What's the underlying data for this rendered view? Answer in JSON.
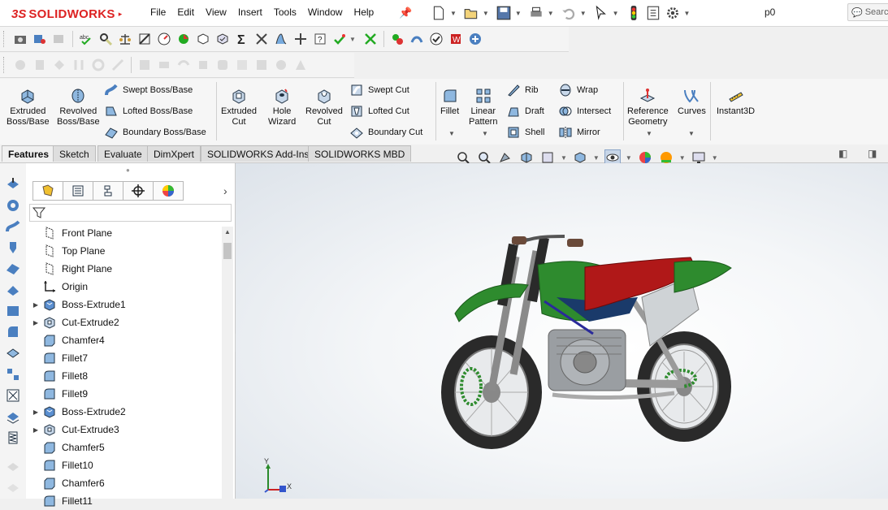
{
  "app": {
    "logo_text": "SOLIDWORKS",
    "document_name": "p0",
    "search_placeholder": "Search"
  },
  "menu": [
    "File",
    "Edit",
    "View",
    "Insert",
    "Tools",
    "Window",
    "Help"
  ],
  "command_manager": {
    "extruded_boss": "Extruded\nBoss/Base",
    "revolved_boss": "Revolved\nBoss/Base",
    "swept_boss": "Swept Boss/Base",
    "lofted_boss": "Lofted Boss/Base",
    "boundary_boss": "Boundary Boss/Base",
    "extruded_cut": "Extruded\nCut",
    "hole_wizard": "Hole\nWizard",
    "revolved_cut": "Revolved\nCut",
    "swept_cut": "Swept Cut",
    "lofted_cut": "Lofted Cut",
    "boundary_cut": "Boundary Cut",
    "fillet": "Fillet",
    "linear_pattern": "Linear\nPattern",
    "rib": "Rib",
    "draft": "Draft",
    "shell": "Shell",
    "wrap": "Wrap",
    "intersect": "Intersect",
    "mirror": "Mirror",
    "reference_geometry": "Reference\nGeometry",
    "curves": "Curves",
    "instant3d": "Instant3D"
  },
  "tabs": [
    {
      "label": "Features",
      "active": true
    },
    {
      "label": "Sketch",
      "active": false
    },
    {
      "label": "Evaluate",
      "active": false
    },
    {
      "label": "DimXpert",
      "active": false
    },
    {
      "label": "SOLIDWORKS Add-Ins",
      "active": false
    },
    {
      "label": "SOLIDWORKS MBD",
      "active": false
    }
  ],
  "feature_tree": [
    {
      "label": "Front Plane",
      "icon": "plane-icon",
      "expandable": false
    },
    {
      "label": "Top Plane",
      "icon": "plane-icon",
      "expandable": false
    },
    {
      "label": "Right Plane",
      "icon": "plane-icon",
      "expandable": false
    },
    {
      "label": "Origin",
      "icon": "origin-icon",
      "expandable": false
    },
    {
      "label": "Boss-Extrude1",
      "icon": "boss-extrude-icon",
      "expandable": true
    },
    {
      "label": "Cut-Extrude2",
      "icon": "cut-extrude-icon",
      "expandable": true
    },
    {
      "label": "Chamfer4",
      "icon": "chamfer-icon",
      "expandable": false
    },
    {
      "label": "Fillet7",
      "icon": "fillet-icon",
      "expandable": false
    },
    {
      "label": "Fillet8",
      "icon": "fillet-icon",
      "expandable": false
    },
    {
      "label": "Fillet9",
      "icon": "fillet-icon",
      "expandable": false
    },
    {
      "label": "Boss-Extrude2",
      "icon": "boss-extrude-icon",
      "expandable": true
    },
    {
      "label": "Cut-Extrude3",
      "icon": "cut-extrude-icon",
      "expandable": true
    },
    {
      "label": "Chamfer5",
      "icon": "chamfer-icon",
      "expandable": false
    },
    {
      "label": "Fillet10",
      "icon": "fillet-icon",
      "expandable": false
    },
    {
      "label": "Chamfer6",
      "icon": "chamfer-icon",
      "expandable": false
    },
    {
      "label": "Fillet11",
      "icon": "fillet-icon",
      "expandable": false
    }
  ],
  "triad": {
    "y": "Y",
    "x": "X"
  },
  "colors": {
    "brand_red": "#d22020",
    "model_green": "#2e8b2e",
    "seat_red": "#b01818",
    "tire": "#2a2a2a"
  }
}
